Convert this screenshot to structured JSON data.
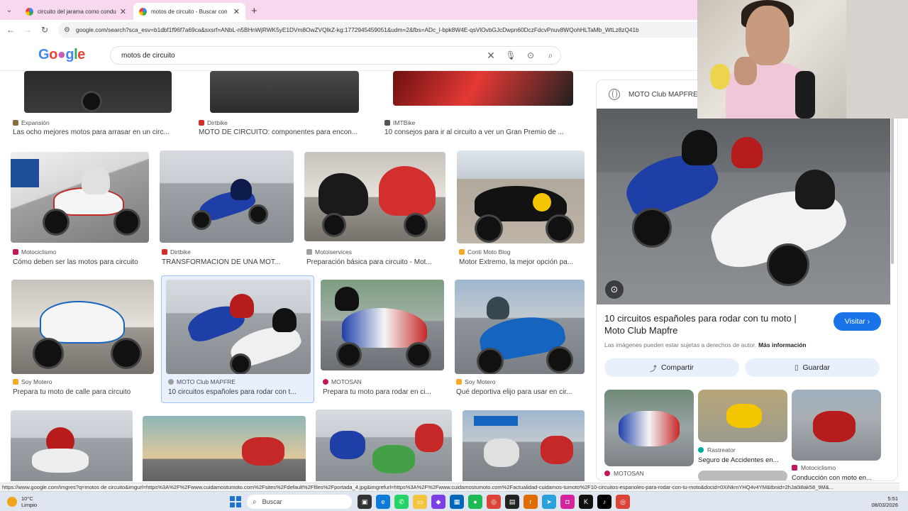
{
  "tabs": [
    {
      "label": "circuito del jarama como condu",
      "active": false
    },
    {
      "label": "motos de circuito - Buscar con",
      "active": true
    }
  ],
  "omnibox": {
    "url": "google.com/search?sca_esv=b1dbf1f96f7a69ca&sxsrf=ANbL-n5BHnWjRWK5yE1DVm8OwZVQIkZ-kg:1772945459051&udm=2&fbs=ADc_l-bpk8W4E-qsVlOvbGJcDwpn60DczFdcvPnuv8WQohHLTaMb_WtLz8zQ41b"
  },
  "search": {
    "query": "motos de circuito"
  },
  "grid": {
    "row1": [
      {
        "source": "Expansión",
        "title": "Las ocho mejores motos para arrasar en un circ...",
        "color": "#8a6d3b"
      },
      {
        "source": "Dirtbike",
        "title": "MOTO DE CIRCUITO: componentes para encon...",
        "color": "#d32f2f"
      },
      {
        "source": "IMTBike",
        "title": "10 consejos para ir al circuito a ver un Gran Premio de ...",
        "color": "#555555"
      }
    ],
    "row2": [
      {
        "source": "Motociclismo",
        "title": "Cómo deben ser las motos para circuito",
        "color": "#c2185b"
      },
      {
        "source": "Dirtbike",
        "title": "TRANSFORMACION DE UNA MOT...",
        "color": "#d32f2f"
      },
      {
        "source": "Motoiservices",
        "title": "Preparación básica para circuito - Mot...",
        "color": "#9e9e9e"
      },
      {
        "source": "Conti Moto Blog",
        "title": "Motor Extremo, la mejor opción pa...",
        "color": "#f9a825"
      }
    ],
    "row3": [
      {
        "source": "Soy Motero",
        "title": "Prepara tu moto de calle para circuito",
        "color": "#f9a825"
      },
      {
        "source": "MOTO Club MAPFRE",
        "title": "10 circuitos españoles para rodar con t...",
        "color": "#9e9e9e"
      },
      {
        "source": "MOTOSAN",
        "title": "Prepara tu moto para rodar en ci...",
        "color": "#c2185b"
      },
      {
        "source": "Soy Motero",
        "title": "Qué deportiva elijo para usar en cir...",
        "color": "#f9a825"
      }
    ]
  },
  "panel": {
    "site": "MOTO Club MAPFRE",
    "title": "10 circuitos españoles para rodar con tu moto | Moto Club Mapfre",
    "visit_label": "Visitar",
    "rights_text": "Las imágenes pueden estar sujetas a derechos de autor.",
    "rights_link": "Más información",
    "share_label": "Compartir",
    "save_label": "Guardar",
    "related": [
      {
        "source": "MOTOSAN",
        "title": "",
        "color": "#c2185b"
      },
      {
        "source": "Rastreator",
        "title": "Seguro de Accidentes en...",
        "color": "#00a99d"
      },
      {
        "source": "Motociclismo",
        "title": "Conducción con moto en...",
        "color": "#c2185b"
      }
    ]
  },
  "status_url": "https://www.google.com/imgres?q=motos de circuito&imgurl=https%3A%2F%2Fwww.cuidamostumoto.com%2Fsites%2Fdefault%2Ffiles%2Fportada_4.jpg&imgrefurl=https%3A%2F%2Fwww.cuidamostumoto.com%2Factualidad-cuidamos-tumoto%2F10-circuitos-espanoles-para-rodar-con-tu-moto&docid=0XiNkmYHQ4v4YM&tbnid=2hJa0i8ak58_9M&...",
  "taskbar": {
    "temp": "10°C",
    "weather": "Limpio",
    "search_label": "Buscar",
    "time": "5:51",
    "date": "08/03/2026"
  },
  "colors": {
    "accent": "#1a73e8",
    "tabbar": "#f8d8ef"
  }
}
